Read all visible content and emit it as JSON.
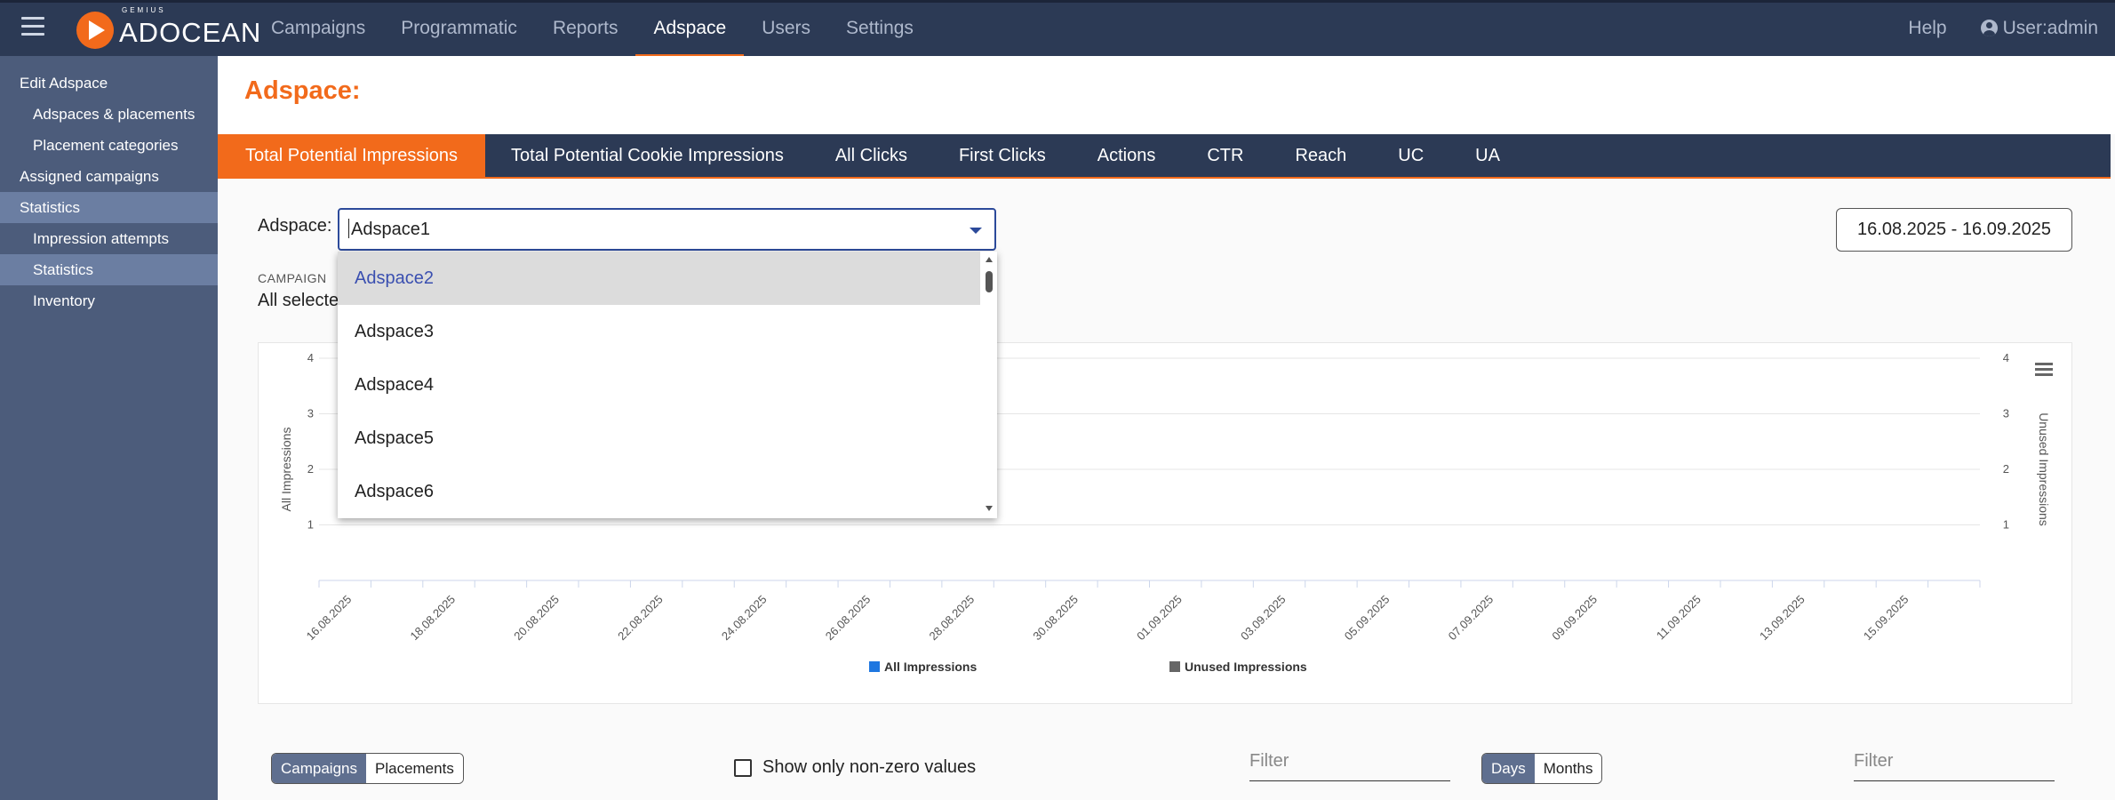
{
  "topbar": {
    "brand": "ADOCEAN",
    "brand_sub": "GEMIUS",
    "nav": [
      "Campaigns",
      "Programmatic",
      "Reports",
      "Adspace",
      "Users",
      "Settings"
    ],
    "active_nav": "Adspace",
    "help": "Help",
    "user": "User:admin"
  },
  "sidebar": {
    "items": [
      {
        "label": "Edit Adspace",
        "level": 0
      },
      {
        "label": "Adspaces & placements",
        "level": 1
      },
      {
        "label": "Placement categories",
        "level": 1
      },
      {
        "label": "Assigned campaigns",
        "level": 0
      },
      {
        "label": "Statistics",
        "level": 0,
        "active": true
      },
      {
        "label": "Impression attempts",
        "level": 1
      },
      {
        "label": "Statistics",
        "level": 1,
        "active": true
      },
      {
        "label": "Inventory",
        "level": 1
      }
    ]
  },
  "page": {
    "title": "Adspace:"
  },
  "tabs": [
    "Total Potential Impressions",
    "Total Potential Cookie Impressions",
    "All Clicks",
    "First Clicks",
    "Actions",
    "CTR",
    "Reach",
    "UC",
    "UA"
  ],
  "filters": {
    "adspace_label": "Adspace:",
    "adspace_value": "Adspace1",
    "date_range": "16.08.2025 - 16.09.2025",
    "campaign_label": "CAMPAIGN",
    "campaign_value": "All selecte"
  },
  "dropdown": {
    "options": [
      "Adspace2",
      "Adspace3",
      "Adspace4",
      "Adspace5",
      "Adspace6"
    ],
    "highlighted": "Adspace2"
  },
  "chart_data": {
    "type": "line",
    "title": "",
    "ylabel": "All Impressions",
    "y2label": "Unused Impressions",
    "yticks": [
      1,
      2,
      3,
      4
    ],
    "y2ticks": [
      1,
      2,
      3,
      4
    ],
    "ylim": [
      0,
      4
    ],
    "xticks": [
      "16.08.2025",
      "18.08.2025",
      "20.08.2025",
      "22.08.2025",
      "24.08.2025",
      "26.08.2025",
      "28.08.2025",
      "30.08.2025",
      "01.09.2025",
      "03.09.2025",
      "05.09.2025",
      "07.09.2025",
      "09.09.2025",
      "11.09.2025",
      "13.09.2025",
      "15.09.2025"
    ],
    "series": [
      {
        "name": "All Impressions",
        "color": "#1f77e0",
        "values": []
      },
      {
        "name": "Unused Impressions",
        "color": "#666666",
        "values": []
      }
    ],
    "grid": true,
    "legend": "bottom-center"
  },
  "bottom": {
    "view_toggle": [
      "Campaigns",
      "Placements"
    ],
    "view_active": "Campaigns",
    "nonzero_label": "Show only non-zero values",
    "filter_placeholder": "Filter",
    "period_toggle": [
      "Days",
      "Months"
    ],
    "period_active": "Days",
    "filter2_placeholder": "Filter"
  }
}
